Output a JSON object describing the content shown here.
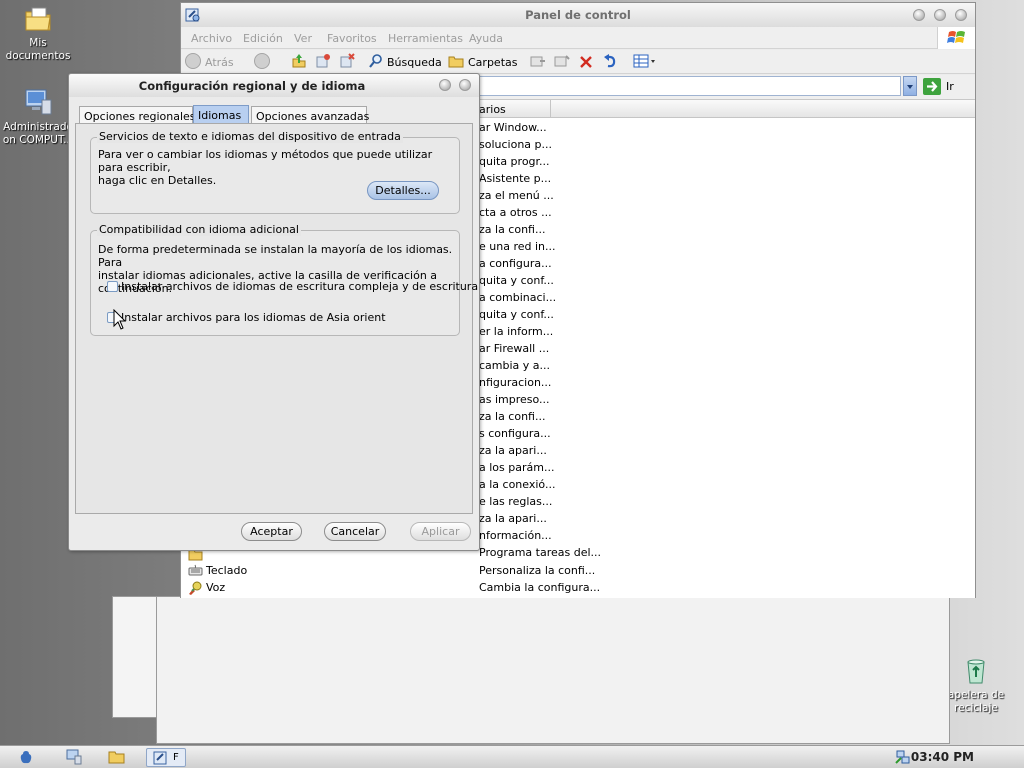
{
  "desktop": {
    "icons": [
      {
        "label": "Mis documentos",
        "icon": "folder-documents-icon"
      },
      {
        "label": "Administrado on COMPUT...",
        "icon": "computer-icon"
      },
      {
        "label": "apelera de reciclaje",
        "icon": "recycle-bin-icon"
      }
    ]
  },
  "control_panel": {
    "title": "Panel de control",
    "menu": [
      "Archivo",
      "Edición",
      "Ver",
      "Favoritos",
      "Herramientas",
      "Ayuda"
    ],
    "toolbar": {
      "back_label": "Atrás",
      "search_label": "Búsqueda",
      "folders_label": "Carpetas"
    },
    "go_label": "Ir",
    "column_header": "arios",
    "comments": [
      "ar Window...",
      "soluciona p...",
      "quita progr...",
      "Asistente p...",
      "za el menú ...",
      "cta a otros ...",
      "za la confi...",
      "e una red in...",
      "a configura...",
      "quita y conf...",
      "a combinaci...",
      "quita y conf...",
      "er la inform...",
      "ar Firewall ...",
      "cambia y a...",
      "nfiguracion...",
      "as impreso...",
      "za la confi...",
      "s configura...",
      "za la apari...",
      "a los parám...",
      "a la conexió...",
      "e las reglas...",
      "za la apari...",
      "nformación...",
      "Programa tareas del..."
    ],
    "bottom_rows": [
      {
        "name": "Teclado",
        "comment": "Personaliza la confi..."
      },
      {
        "name": "Voz",
        "comment": "Cambia la configura..."
      }
    ]
  },
  "dialog": {
    "title": "Configuración regional y de idioma",
    "tabs": [
      "Opciones regionales",
      "Idiomas",
      "Opciones avanzadas"
    ],
    "selected_tab": "Idiomas",
    "group1": {
      "title": "Servicios de texto e idiomas del dispositivo de entrada",
      "line1": "Para ver o cambiar los idiomas y métodos que puede utilizar para escribir,",
      "line2": "haga clic en Detalles.",
      "details_button": "Detalles..."
    },
    "group2": {
      "title": "Compatibilidad con idioma adicional",
      "line1": "De forma predeterminada se instalan la mayoría de los idiomas. Para",
      "line2": "instalar idiomas adicionales, active la casilla de verificación a continuación.",
      "checkbox1": "Instalar archivos de idiomas de escritura compleja y de escritura",
      "checkbox2": "Instalar archivos para los idiomas de Asia orient"
    },
    "buttons": {
      "ok": "Aceptar",
      "cancel": "Cancelar",
      "apply": "Aplicar"
    }
  },
  "taskbar": {
    "items": [
      "",
      "F"
    ],
    "clock": "03:40 PM"
  }
}
